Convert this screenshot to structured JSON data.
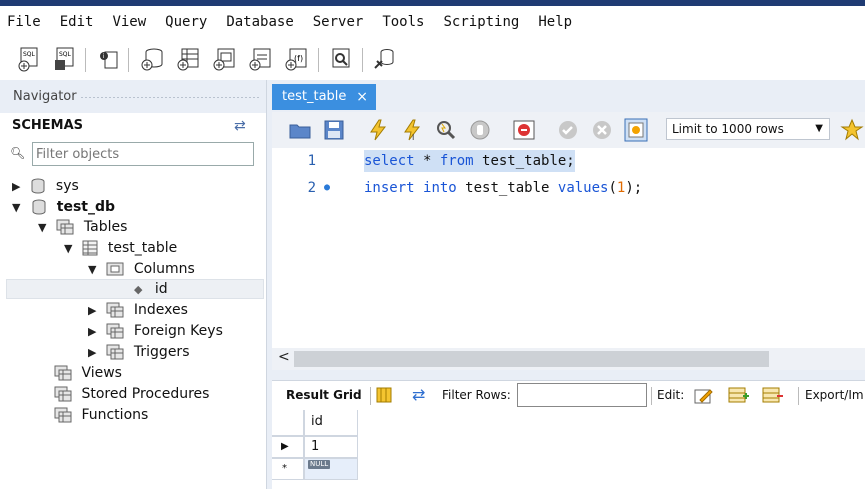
{
  "menu": [
    "File",
    "Edit",
    "View",
    "Query",
    "Database",
    "Server",
    "Tools",
    "Scripting",
    "Help"
  ],
  "navigator": {
    "title": "Navigator",
    "schemas_label": "SCHEMAS",
    "filter_placeholder": "Filter objects",
    "tree": {
      "sys": "sys",
      "test_db": "test_db",
      "tables": "Tables",
      "test_table": "test_table",
      "columns": "Columns",
      "id": "id",
      "indexes": "Indexes",
      "foreign_keys": "Foreign Keys",
      "triggers": "Triggers",
      "views": "Views",
      "stored_procedures": "Stored Procedures",
      "functions": "Functions"
    }
  },
  "tab": {
    "label": "test_table",
    "close": "×"
  },
  "editor_toolbar": {
    "limit": "Limit to 1000 rows"
  },
  "editor": {
    "lines": [
      {
        "num": "1",
        "kw1": "select",
        "rest": " * ",
        "kw2": "from",
        "tail": " test_table;"
      },
      {
        "num": "2",
        "kw1": "insert",
        "rest": " ",
        "kw2": "into",
        "mid": " test_table ",
        "kw3": "values",
        "open": "(",
        "val": "1",
        "close": ");"
      }
    ]
  },
  "result": {
    "grid_label": "Result Grid",
    "filter_label": "Filter Rows:",
    "edit_label": "Edit:",
    "export_label": "Export/Im",
    "column": "id",
    "rows": [
      "1"
    ],
    "null_label": "NULL"
  },
  "colors": {
    "accent": "#3b8fe0",
    "keyword": "#1a55d6",
    "number": "#e06a00"
  }
}
